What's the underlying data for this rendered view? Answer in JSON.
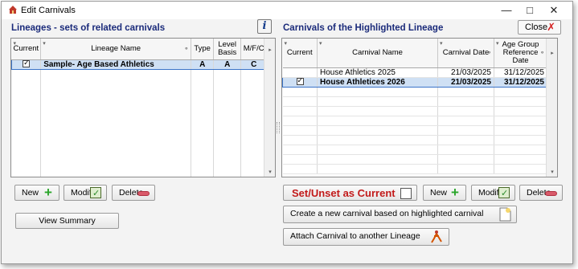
{
  "window": {
    "title": "Edit Carnivals",
    "min": "—",
    "max": "□",
    "close": "✕"
  },
  "left": {
    "title": "Lineages - sets of related carnivals",
    "info_label": "i",
    "columns": [
      "Current",
      "Lineage Name",
      "Type",
      "Level Basis",
      "M/F/C"
    ],
    "rows": [
      {
        "current": true,
        "name": "Sample- Age Based  Athletics",
        "type": "A",
        "level": "A",
        "mfc": "C"
      }
    ],
    "buttons": {
      "new": "New",
      "modify": "Modify",
      "delete": "Delete",
      "view_summary": "View Summary"
    }
  },
  "right": {
    "title": "Carnivals of the Highlighted Lineage",
    "close_label": "Close",
    "columns": [
      "Current",
      "Carnival Name",
      "Carnival Date",
      "Age Group Reference Date"
    ],
    "rows": [
      {
        "current": false,
        "name": "House Athletics 2025",
        "date": "21/03/2025",
        "ref": "31/12/2025"
      },
      {
        "current": true,
        "name": "House Athletices 2026",
        "date": "21/03/2025",
        "ref": "31/12/2025"
      }
    ],
    "buttons": {
      "set_unset": "Set/Unset as Current",
      "new": "New",
      "modify": "Modify",
      "delete": "Delete",
      "create_based": "Create a new carnival based on highlighted carnival",
      "attach": "Attach Carnival to another Lineage"
    }
  }
}
